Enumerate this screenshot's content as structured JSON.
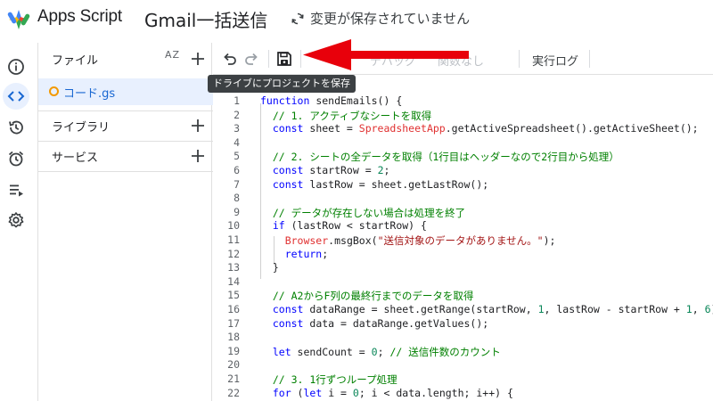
{
  "header": {
    "brand": "Apps Script",
    "project_title": "Gmail一括送信",
    "save_status": "変更が保存されていません"
  },
  "rail": {
    "items": [
      {
        "icon": "info-icon"
      },
      {
        "icon": "code-icon",
        "active": true
      },
      {
        "icon": "history-icon"
      },
      {
        "icon": "alarm-clock-icon"
      },
      {
        "icon": "executions-icon"
      },
      {
        "icon": "gear-icon"
      }
    ]
  },
  "sidebar": {
    "files_label": "ファイル",
    "sort_label": "AZ",
    "file_name": "コード.gs",
    "libraries_label": "ライブラリ",
    "services_label": "サービス"
  },
  "toolbar": {
    "debug_label": "デバッグ",
    "function_label": "関数なし",
    "log_label": "実行ログ"
  },
  "tooltip": {
    "text": "ドライブにプロジェクトを保存"
  },
  "colors": {
    "accent": "#1967d2",
    "active_bg": "#e8f0fe",
    "arrow": "#e8000b",
    "file_dot": "#f29900"
  },
  "editor": {
    "lines": [
      {
        "n": "1",
        "tokens": [
          [
            "kw",
            "function "
          ],
          [
            "fn",
            "sendEmails() {"
          ]
        ]
      },
      {
        "n": "2",
        "tokens": [
          [
            "cm",
            "  // 1. アクティブなシートを取得"
          ]
        ]
      },
      {
        "n": "3",
        "tokens": [
          [
            "kw",
            "  const "
          ],
          [
            "fn",
            "sheet = "
          ],
          [
            "cls",
            "SpreadsheetApp"
          ],
          [
            "fn",
            ".getActiveSpreadsheet().getActiveSheet();"
          ]
        ]
      },
      {
        "n": "4",
        "tokens": []
      },
      {
        "n": "5",
        "tokens": [
          [
            "cm",
            "  // 2. シートの全データを取得（1行目はヘッダーなので2行目から処理）"
          ]
        ]
      },
      {
        "n": "6",
        "tokens": [
          [
            "kw",
            "  const "
          ],
          [
            "fn",
            "startRow = "
          ],
          [
            "num",
            "2"
          ],
          [
            "fn",
            ";"
          ]
        ]
      },
      {
        "n": "7",
        "tokens": [
          [
            "kw",
            "  const "
          ],
          [
            "fn",
            "lastRow = sheet.getLastRow();"
          ]
        ]
      },
      {
        "n": "8",
        "tokens": []
      },
      {
        "n": "9",
        "tokens": [
          [
            "cm",
            "  // データが存在しない場合は処理を終了"
          ]
        ]
      },
      {
        "n": "10",
        "tokens": [
          [
            "kw",
            "  if "
          ],
          [
            "fn",
            "(lastRow < startRow) {"
          ]
        ]
      },
      {
        "n": "11",
        "tokens": [
          [
            "cls",
            "    Browser"
          ],
          [
            "fn",
            ".msgBox("
          ],
          [
            "str",
            "\"送信対象のデータがありません。\""
          ],
          [
            "fn",
            ");"
          ]
        ]
      },
      {
        "n": "12",
        "tokens": [
          [
            "kw",
            "    return"
          ],
          [
            "fn",
            ";"
          ]
        ]
      },
      {
        "n": "13",
        "tokens": [
          [
            "fn",
            "  }"
          ]
        ]
      },
      {
        "n": "14",
        "tokens": []
      },
      {
        "n": "15",
        "tokens": [
          [
            "cm",
            "  // A2からF列の最終行までのデータを取得"
          ]
        ]
      },
      {
        "n": "16",
        "tokens": [
          [
            "kw",
            "  const "
          ],
          [
            "fn",
            "dataRange = sheet.getRange(startRow, "
          ],
          [
            "num",
            "1"
          ],
          [
            "fn",
            ", lastRow - startRow + "
          ],
          [
            "num",
            "1"
          ],
          [
            "fn",
            ", "
          ],
          [
            "num",
            "6"
          ],
          [
            "fn",
            ");"
          ]
        ]
      },
      {
        "n": "17",
        "tokens": [
          [
            "kw",
            "  const "
          ],
          [
            "fn",
            "data = dataRange.getValues();"
          ]
        ]
      },
      {
        "n": "18",
        "tokens": []
      },
      {
        "n": "19",
        "tokens": [
          [
            "kw",
            "  let "
          ],
          [
            "fn",
            "sendCount = "
          ],
          [
            "num",
            "0"
          ],
          [
            "fn",
            "; "
          ],
          [
            "cm",
            "// 送信件数のカウント"
          ]
        ]
      },
      {
        "n": "20",
        "tokens": []
      },
      {
        "n": "21",
        "tokens": [
          [
            "cm",
            "  // 3. 1行ずつループ処理"
          ]
        ]
      },
      {
        "n": "22",
        "tokens": [
          [
            "kw",
            "  for "
          ],
          [
            "fn",
            "("
          ],
          [
            "kw",
            "let "
          ],
          [
            "fn",
            "i = "
          ],
          [
            "num",
            "0"
          ],
          [
            "fn",
            "; i < data.length; i++) {"
          ]
        ]
      }
    ]
  }
}
